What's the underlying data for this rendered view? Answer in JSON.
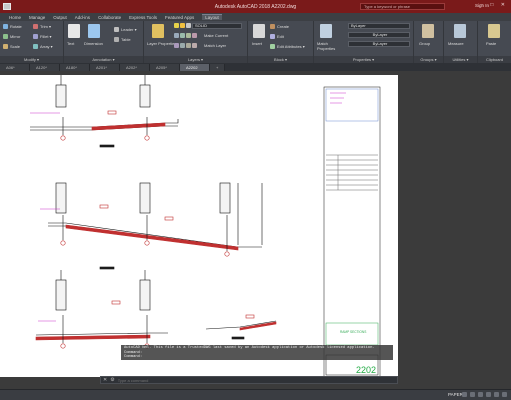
{
  "window": {
    "title": "Autodesk AutoCAD 2018    A2202.dwg",
    "search_placeholder": "Type a keyword or phrase",
    "signin": "Sign In",
    "controls": "–  □  ✕"
  },
  "menu": [
    "Home",
    "Manage",
    "Output",
    "Add-ins",
    "Collaborate",
    "Express Tools",
    "Featured Apps",
    "Layout"
  ],
  "menu_active_index": 7,
  "ribbon": {
    "modify": {
      "title": "Modify ▾",
      "rotate": "Rotate",
      "mirror": "Mirror",
      "scale": "Scale",
      "trim": "Trim ▾",
      "fillet": "Fillet ▾",
      "array": "Array ▾"
    },
    "annotation": {
      "title": "Annotation ▾",
      "text": "Text",
      "dimension": "Dimension",
      "leader": "Leader ▾",
      "table": "Table"
    },
    "layers": {
      "title": "Layers ▾",
      "layer_properties": "Layer Properties",
      "current_layer": "SOLID",
      "make_current": "Make Current",
      "match_layer": "Match Layer"
    },
    "block": {
      "title": "Block ▾",
      "insert": "Insert",
      "create": "Create",
      "edit": "Edit",
      "edit_attributes": "Edit Attributes ▾"
    },
    "properties": {
      "title": "Properties ▾",
      "match_properties": "Match Properties",
      "color": "ByLayer",
      "linetype": "ByLayer",
      "lineweight": "ByLayer"
    },
    "groups": {
      "title": "Groups ▾",
      "group": "Group"
    },
    "utilities": {
      "title": "Utilities ▾",
      "measure": "Measure"
    },
    "clipboard": {
      "title": "Clipboard",
      "paste": "Paste"
    }
  },
  "doc_tabs": [
    "A06*",
    "A120*",
    "A180*",
    "A201*",
    "A202*",
    "A205*",
    "A2202"
  ],
  "doc_tab_active_index": 6,
  "drawing": {
    "sheet_number": "2202",
    "title_block_label": "RAMP SECTIONS"
  },
  "command_history": [
    "AutoCAD bml. This file is a TrustedDWG last saved by an Autodesk application or Autodesk licensed application.",
    "Command:",
    "Command:"
  ],
  "command_prompt": "Type a command",
  "status": {
    "space": "PAPER"
  },
  "colors": {
    "titlebar": "#7a1a1a",
    "ribbon": "#464a52",
    "section_fill": "#c03030",
    "annotation_magenta": "#cc33cc",
    "sheet_number": "#22aa44"
  }
}
